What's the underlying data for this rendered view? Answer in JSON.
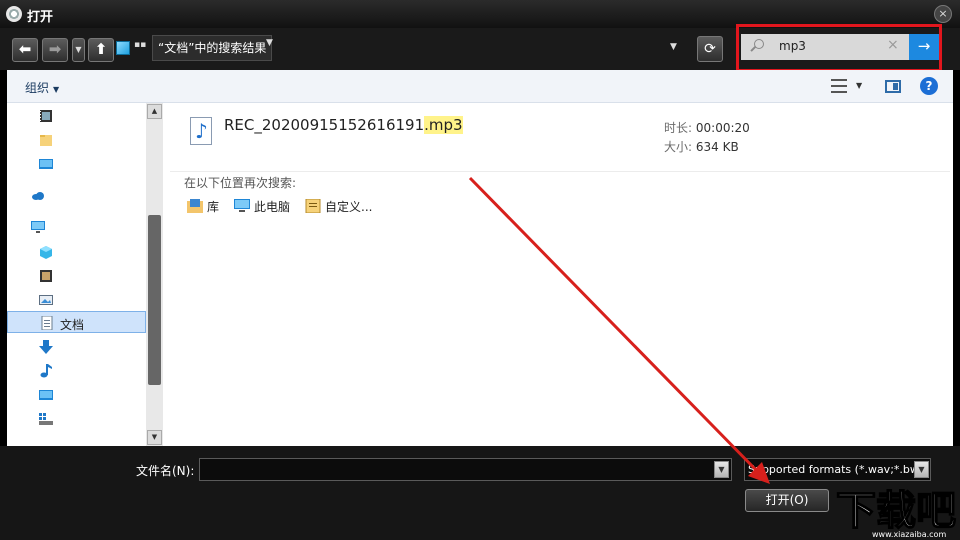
{
  "window": {
    "title": "打开",
    "close_glyph": "×"
  },
  "nav": {
    "back_glyph": "⬅",
    "forward_glyph": "➡",
    "up_glyph": "⬆",
    "refresh_glyph": "⟳",
    "breadcrumb_more": "▪▪",
    "breadcrumb": "“文档”中的搜索结果"
  },
  "search": {
    "value": "mp3",
    "clear_glyph": "×",
    "go_glyph": "→"
  },
  "toolbar": {
    "organize_label": "组织",
    "help_glyph": "?"
  },
  "sidebar": {
    "items": [
      {
        "icon": "video-icon",
        "label": ""
      },
      {
        "icon": "folder-icon",
        "label": ""
      },
      {
        "icon": "desktop-icon",
        "label": ""
      },
      {
        "icon": "cloud-icon",
        "label": ""
      },
      {
        "icon": "computer-icon",
        "label": ""
      },
      {
        "icon": "3d-objects-icon",
        "label": ""
      },
      {
        "icon": "video-icon",
        "label": ""
      },
      {
        "icon": "pictures-icon",
        "label": ""
      },
      {
        "icon": "documents-icon",
        "label": "文档",
        "selected": true
      },
      {
        "icon": "download-icon",
        "label": ""
      },
      {
        "icon": "music-icon",
        "label": ""
      },
      {
        "icon": "desktop-icon",
        "label": ""
      },
      {
        "icon": "drive-icon",
        "label": ""
      }
    ]
  },
  "results": {
    "file": {
      "name_base": "REC_20200915152616191",
      "name_ext": ".mp3",
      "duration_label": "时长:",
      "duration": "00:00:20",
      "size_label": "大小:",
      "size": "634 KB"
    },
    "search_again_label": "在以下位置再次搜索:",
    "locations": [
      {
        "icon": "library-icon",
        "label": "库"
      },
      {
        "icon": "computer-icon",
        "label": "此电脑"
      },
      {
        "icon": "custom-icon",
        "label": "自定义..."
      }
    ]
  },
  "bottom": {
    "filename_label": "文件名(N):",
    "filename_value": "",
    "filter_value": "Supported formats (*.wav;*.bwf",
    "open_label": "打开(O)",
    "watermark_text": "下载吧",
    "watermark_url": "www.xiazaiba.com"
  },
  "colors": {
    "highlight": "#e2161d",
    "accent": "#1d89e0",
    "arrow": "#d7201c"
  }
}
